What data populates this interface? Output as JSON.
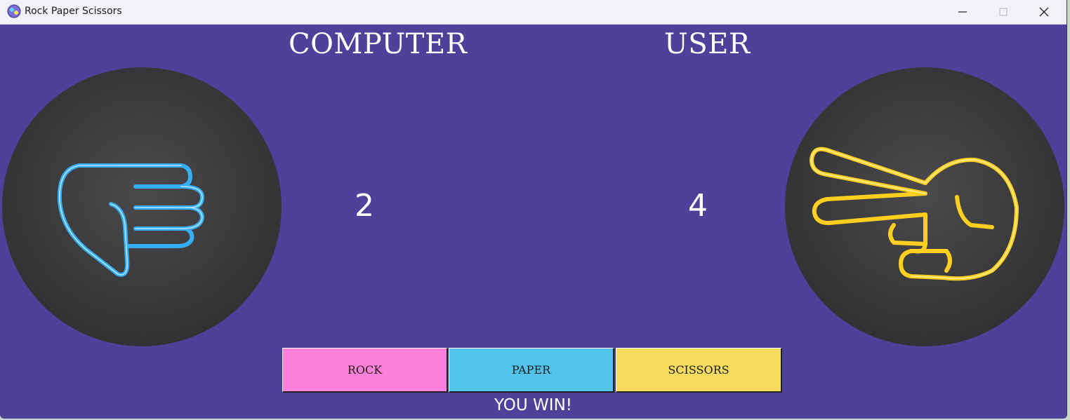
{
  "window": {
    "title": "Rock Paper Scissors",
    "icon": "app-icon",
    "controls": [
      "minimize-icon",
      "maximize-icon",
      "close-icon"
    ]
  },
  "players": {
    "computer": {
      "label": "COMPUTER",
      "score": "2",
      "hand_image": "paper-hand-blue-neon",
      "hand_color": "#35aef5"
    },
    "user": {
      "label": "USER",
      "score": "4",
      "hand_image": "scissors-hand-yellow-neon",
      "hand_color": "#ffcf1f"
    }
  },
  "buttons": {
    "rock": {
      "label": "ROCK",
      "color": "#ff80d8"
    },
    "paper": {
      "label": "PAPER",
      "color": "#50c4ec"
    },
    "scissors": {
      "label": "SCISSORS",
      "color": "#f4db5e"
    }
  },
  "result": "YOU WIN!",
  "colors": {
    "background": "#50409a",
    "text": "#ffffff"
  }
}
